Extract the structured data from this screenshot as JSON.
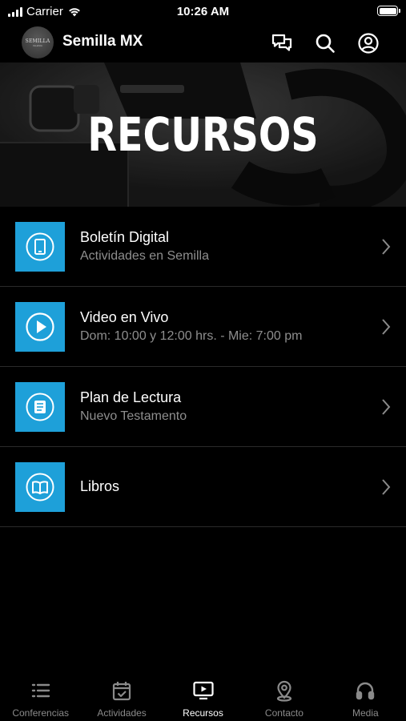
{
  "status_bar": {
    "carrier": "Carrier",
    "time": "10:26 AM"
  },
  "header": {
    "app_name": "Semilla MX",
    "avatar_text": "SEMILLA",
    "avatar_subtext": "IGLESIA"
  },
  "hero": {
    "title": "RECURSOS"
  },
  "resources": [
    {
      "title": "Boletín Digital",
      "subtitle": "Actividades en Semilla",
      "icon": "tablet-icon"
    },
    {
      "title": "Video en Vivo",
      "subtitle": "Dom: 10:00 y 12:00 hrs. - Mie: 7:00 pm",
      "icon": "play-icon"
    },
    {
      "title": "Plan de Lectura",
      "subtitle": "Nuevo Testamento",
      "icon": "reading-plan-icon"
    },
    {
      "title": "Libros",
      "subtitle": "",
      "icon": "book-icon"
    }
  ],
  "tabs": [
    {
      "label": "Conferencias",
      "icon": "list-icon",
      "active": false
    },
    {
      "label": "Actividades",
      "icon": "calendar-check-icon",
      "active": false
    },
    {
      "label": "Recursos",
      "icon": "tv-play-icon",
      "active": true
    },
    {
      "label": "Contacto",
      "icon": "location-pin-icon",
      "active": false
    },
    {
      "label": "Media",
      "icon": "headphones-icon",
      "active": false
    }
  ],
  "colors": {
    "accent": "#1ea0d9",
    "background": "#000000",
    "subtitle": "#8e8e8e",
    "tab_inactive": "#8a8a8a"
  }
}
